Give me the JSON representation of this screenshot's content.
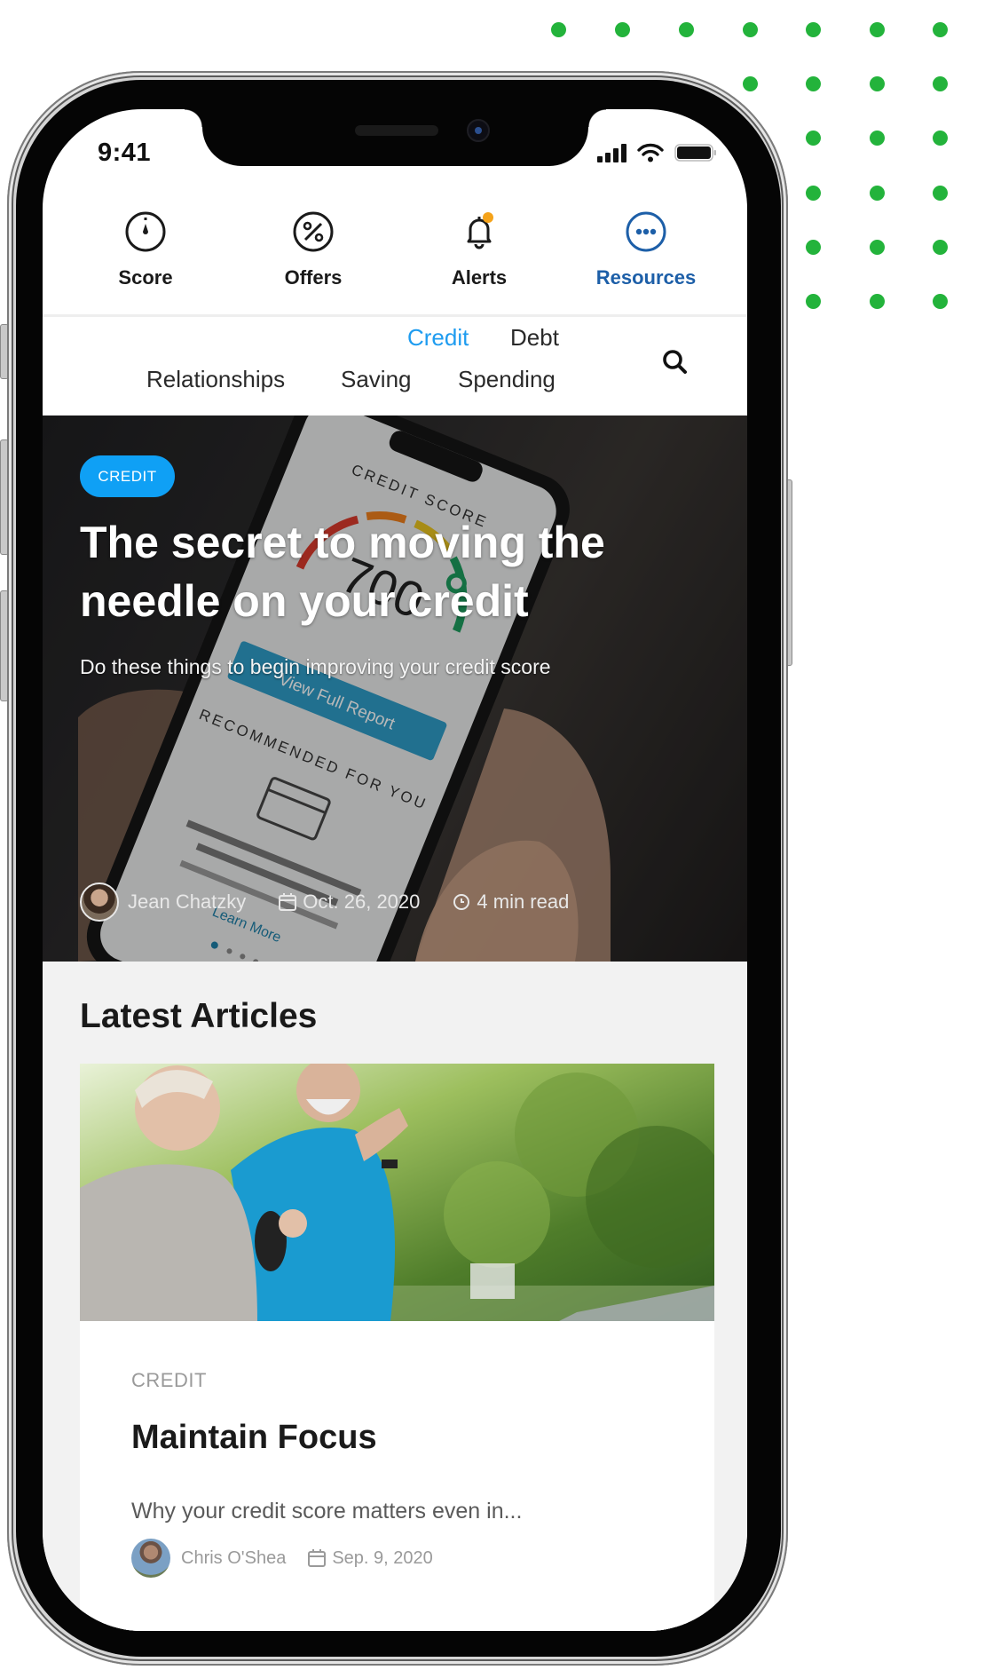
{
  "decoration": {
    "dot_color": "#23b33b",
    "dot_rows": [
      7,
      4,
      3,
      3,
      3,
      3
    ]
  },
  "status_bar": {
    "time": "9:41",
    "icons": [
      "cellular-signal-icon",
      "wifi-icon",
      "battery-icon"
    ]
  },
  "tabs": [
    {
      "label": "Score",
      "icon": "gauge-icon",
      "active": false
    },
    {
      "label": "Offers",
      "icon": "percent-icon",
      "active": false
    },
    {
      "label": "Alerts",
      "icon": "bell-icon",
      "active": false,
      "badge_color": "#f5a31a"
    },
    {
      "label": "Resources",
      "icon": "more-dots-icon",
      "active": true
    }
  ],
  "subnav": {
    "items": [
      {
        "label": "Credit",
        "active": true
      },
      {
        "label": "Debt",
        "active": false
      },
      {
        "label": "Relationships",
        "active": false
      },
      {
        "label": "Saving",
        "active": false
      },
      {
        "label": "Spending",
        "active": false
      }
    ],
    "search_icon": "search-icon"
  },
  "hero": {
    "badge": "CREDIT",
    "title": "The secret to moving the needle on your credit",
    "subtitle": "Do these things to begin improving your credit score",
    "author": "Jean Chatzky",
    "date": "Oct. 26, 2020",
    "read_time": "4 min read",
    "photo_text": {
      "header": "CREDIT SCORE",
      "score": "700",
      "button": "View Full Report",
      "section": "RECOMMENDED FOR YOU",
      "link": "Learn More"
    },
    "accent_color": "#0fa0f5"
  },
  "latest": {
    "title": "Latest Articles",
    "articles": [
      {
        "category": "CREDIT",
        "title": "Maintain Focus",
        "excerpt": "Why your credit score matters even in...",
        "author": "Chris O'Shea",
        "date": "Sep. 9, 2020"
      }
    ]
  },
  "colors": {
    "active_tab": "#1d5fa8",
    "active_subnav": "#1e9cf0",
    "section_bg": "#f2f2f2"
  }
}
